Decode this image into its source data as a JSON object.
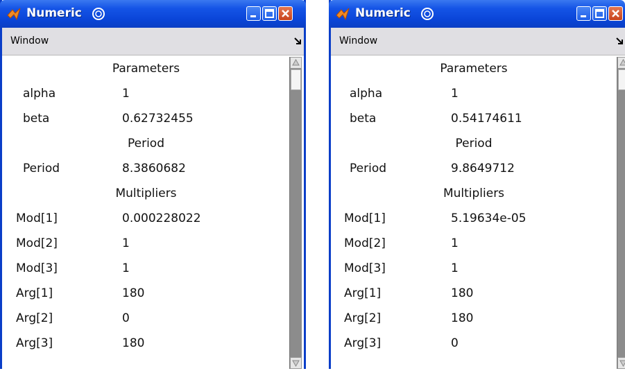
{
  "windows": [
    {
      "title": "Numeric",
      "menu": "Window",
      "sections": {
        "parameters": "Parameters",
        "period": "Period",
        "multipliers": "Multipliers"
      },
      "params": [
        {
          "label": "alpha",
          "value": "1"
        },
        {
          "label": "beta",
          "value": "0.62732455"
        }
      ],
      "period": {
        "label": "Period",
        "value": "8.3860682"
      },
      "multipliers": [
        {
          "label": "Mod[1]",
          "value": "0.000228022"
        },
        {
          "label": "Mod[2]",
          "value": "1"
        },
        {
          "label": "Mod[3]",
          "value": "1"
        },
        {
          "label": "Arg[1]",
          "value": "180"
        },
        {
          "label": "Arg[2]",
          "value": "0"
        },
        {
          "label": "Arg[3]",
          "value": "180"
        }
      ]
    },
    {
      "title": "Numeric",
      "menu": "Window",
      "sections": {
        "parameters": "Parameters",
        "period": "Period",
        "multipliers": "Multipliers"
      },
      "params": [
        {
          "label": "alpha",
          "value": "1"
        },
        {
          "label": "beta",
          "value": "0.54174611"
        }
      ],
      "period": {
        "label": "Period",
        "value": "9.8649712"
      },
      "multipliers": [
        {
          "label": "Mod[1]",
          "value": "5.19634e-05"
        },
        {
          "label": "Mod[2]",
          "value": "1"
        },
        {
          "label": "Mod[3]",
          "value": "1"
        },
        {
          "label": "Arg[1]",
          "value": "180"
        },
        {
          "label": "Arg[2]",
          "value": "180"
        },
        {
          "label": "Arg[3]",
          "value": "0"
        }
      ]
    }
  ],
  "colors": {
    "titlebar": "#0a45d8",
    "menubar": "#e0dfe3",
    "close_button": "#c7431c"
  },
  "icons": [
    "matlab-icon",
    "swirl-icon",
    "minimize-icon",
    "maximize-icon",
    "close-icon",
    "menu-arrow-icon",
    "scroll-up-icon",
    "scroll-down-icon"
  ]
}
